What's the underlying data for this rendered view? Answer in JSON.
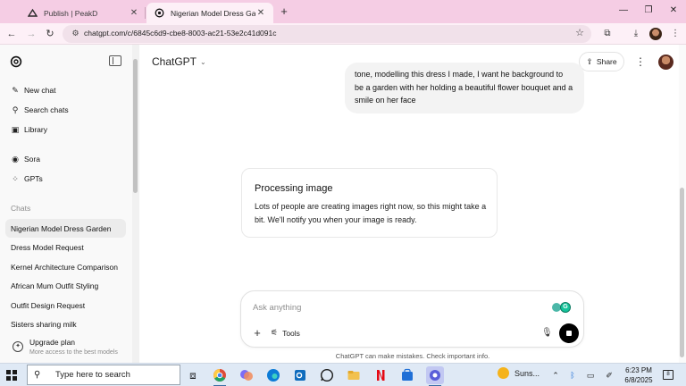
{
  "browser": {
    "tabs": [
      {
        "title": "Publish | PeakD",
        "icon": "peakd-icon"
      },
      {
        "title": "Nigerian Model Dress Garden",
        "icon": "chatgpt-favicon"
      }
    ],
    "url": "chatgpt.com/c/6845c6d9-cbe8-8003-ac21-53e2c41d091c"
  },
  "sidebar": {
    "nav": [
      {
        "label": "New chat",
        "icon": "new-chat-icon"
      },
      {
        "label": "Search chats",
        "icon": "search-icon"
      },
      {
        "label": "Library",
        "icon": "library-icon"
      },
      {
        "label": "Sora",
        "icon": "sora-icon"
      },
      {
        "label": "GPTs",
        "icon": "gpts-icon"
      }
    ],
    "section_label": "Chats",
    "chats": [
      "Nigerian Model Dress Garden",
      "Dress Model Request",
      "Kernel Architecture Comparison",
      "African Mum Outfit Styling",
      "Outfit Design Request",
      "Sisters sharing milk"
    ],
    "upgrade": {
      "title": "Upgrade plan",
      "subtitle": "More access to the best models"
    }
  },
  "header": {
    "model": "ChatGPT",
    "share_label": "Share"
  },
  "conversation": {
    "user_message": "tone, modelling this dress I made, I want he background to be a garden with her holding a beautiful flower bouquet and a smile on her face",
    "processing": {
      "title": "Processing image",
      "description": "Lots of people are creating images right now, so this might take a bit. We'll notify you when your image is ready."
    }
  },
  "composer": {
    "placeholder": "Ask anything",
    "tools_label": "Tools",
    "disclaimer": "ChatGPT can make mistakes. Check important info."
  },
  "taskbar": {
    "search_placeholder": "Type here to search",
    "weather": "Suns...",
    "time": "6:23 PM",
    "date": "6/8/2025",
    "notification_count": "8"
  }
}
